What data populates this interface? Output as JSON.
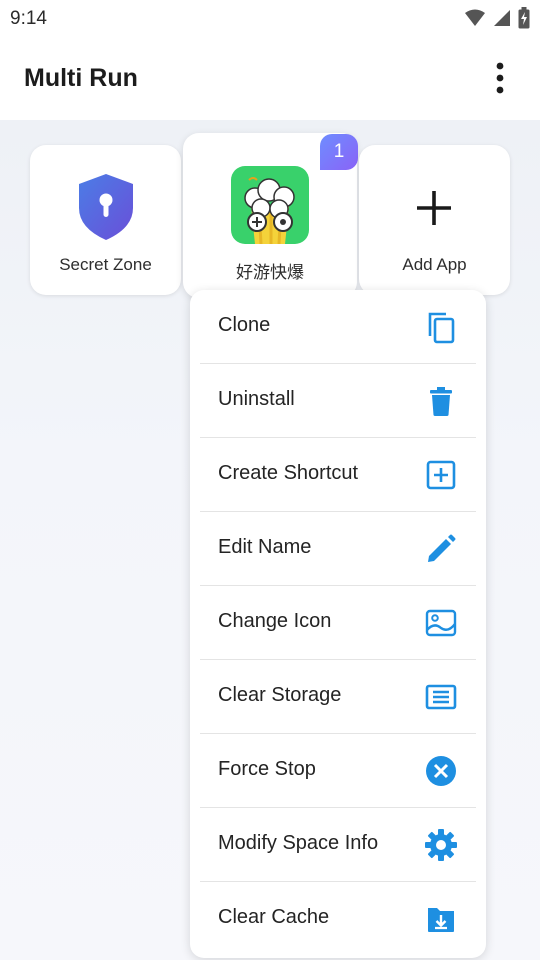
{
  "status_bar": {
    "time": "9:14",
    "icons": [
      "wifi-icon",
      "cellular-signal-icon",
      "battery-charging-icon"
    ]
  },
  "app_bar": {
    "title": "Multi Run",
    "menu_icon": "more-vert-icon"
  },
  "apps": [
    {
      "label": "Secret Zone",
      "icon": "shield-keyhole-icon"
    },
    {
      "label": "好游快爆",
      "icon": "popcorn-app-icon",
      "badge": "1"
    },
    {
      "label": "Add App",
      "icon": "plus-icon"
    }
  ],
  "context_menu": {
    "accent_color": "#1e8fe1",
    "items": [
      {
        "label": "Clone",
        "icon": "copy-icon"
      },
      {
        "label": "Uninstall",
        "icon": "trash-icon"
      },
      {
        "label": "Create Shortcut",
        "icon": "add-box-icon"
      },
      {
        "label": "Edit Name",
        "icon": "pencil-icon"
      },
      {
        "label": "Change Icon",
        "icon": "image-icon"
      },
      {
        "label": "Clear Storage",
        "icon": "storage-list-icon"
      },
      {
        "label": "Force Stop",
        "icon": "close-circle-icon"
      },
      {
        "label": "Modify Space Info",
        "icon": "gear-icon"
      },
      {
        "label": "Clear Cache",
        "icon": "folder-download-icon"
      }
    ]
  }
}
